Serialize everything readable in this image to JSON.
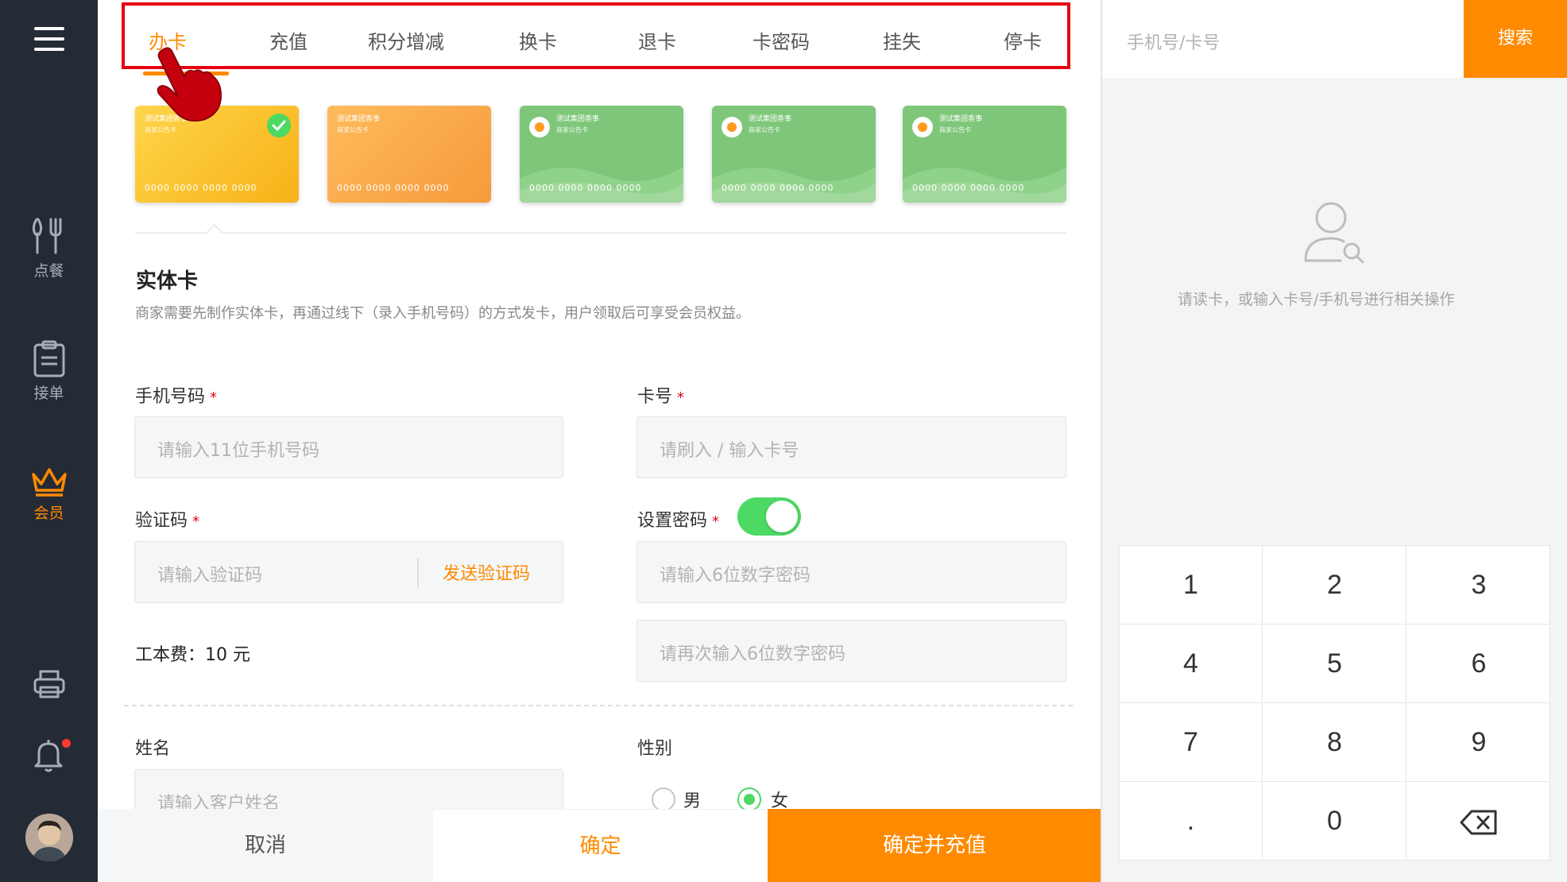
{
  "sidebar": {
    "items": [
      {
        "label": "点餐",
        "icon": "utensils-icon"
      },
      {
        "label": "接单",
        "icon": "clipboard-icon"
      },
      {
        "label": "会员",
        "icon": "crown-icon"
      }
    ],
    "bottom_icons": [
      "printer-icon",
      "bell-icon",
      "avatar"
    ]
  },
  "tabs": [
    {
      "label": "办卡",
      "active": true
    },
    {
      "label": "充值"
    },
    {
      "label": "积分增减"
    },
    {
      "label": "换卡"
    },
    {
      "label": "退卡"
    },
    {
      "label": "卡密码"
    },
    {
      "label": "挂失"
    },
    {
      "label": "停卡"
    }
  ],
  "cards": [
    {
      "color": "yellow",
      "brand": "测试集团香事",
      "sub": "商家公告卡",
      "number": "0000 0000 0000 0000",
      "selected": true
    },
    {
      "color": "orange",
      "brand": "测试集团香事",
      "sub": "商家公告卡",
      "number": "0000 0000 0000 0000"
    },
    {
      "color": "green",
      "brand": "测试集团香事",
      "sub": "商家公告卡",
      "number": "0000 0000 0000 0000"
    },
    {
      "color": "green",
      "brand": "测试集团香事",
      "sub": "商家公告卡",
      "number": "0000 0000 0000 0000"
    },
    {
      "color": "green",
      "brand": "测试集团香事",
      "sub": "商家公告卡",
      "number": "0000 0000 0000 0000"
    }
  ],
  "section": {
    "title": "实体卡",
    "desc": "商家需要先制作实体卡，再通过线下（录入手机号码）的方式发卡，用户领取后可享受会员权益。"
  },
  "form": {
    "phone_label": "手机号码",
    "phone_placeholder": "请输入11位手机号码",
    "card_label": "卡号",
    "card_placeholder": "请刷入 / 输入卡号",
    "code_label": "验证码",
    "code_placeholder": "请输入验证码",
    "send_code": "发送验证码",
    "pwd_label": "设置密码",
    "pwd_enabled": true,
    "pwd_placeholder": "请输入6位数字密码",
    "pwd_confirm_placeholder": "请再次输入6位数字密码",
    "fee_text": "工本费：10 元",
    "name_label": "姓名",
    "name_placeholder": "请输入客户姓名",
    "gender_label": "性别",
    "gender_male": "男",
    "gender_female": "女",
    "gender_selected": "女",
    "required_mark": "*"
  },
  "actions": {
    "cancel": "取消",
    "confirm": "确定",
    "confirm_charge": "确定并充值"
  },
  "right_panel": {
    "search_placeholder": "手机号/卡号",
    "search_button": "搜索",
    "empty_hint": "请读卡，或输入卡号/手机号进行相关操作",
    "keys": [
      "1",
      "2",
      "3",
      "4",
      "5",
      "6",
      "7",
      "8",
      "9",
      ".",
      "0",
      "backspace-icon"
    ]
  },
  "colors": {
    "accent": "#ff8a00",
    "sidebar_bg": "#252b35",
    "toggle_on": "#4cd964",
    "tab_highlight_border": "#e60012"
  }
}
